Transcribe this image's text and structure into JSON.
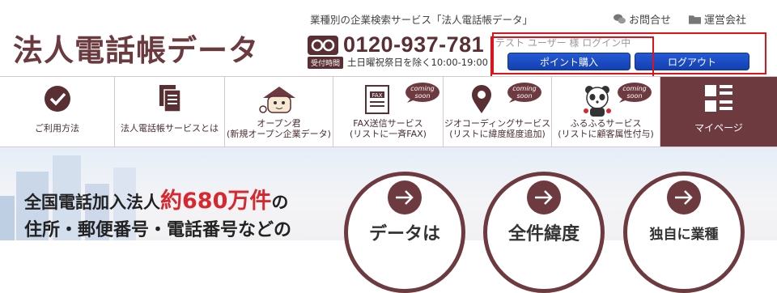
{
  "header": {
    "logo": "法人電話帳データ",
    "tagline": "業種別の企業検索サービス「法人電話帳データ」",
    "links": [
      {
        "label": "お問合せ",
        "icon": "chat-icon"
      },
      {
        "label": "運営会社",
        "icon": "folder-icon"
      }
    ],
    "phone": "0120-937-781",
    "hours_badge": "受付時間",
    "hours": "土日曜祝祭日を除く10:00-19:00",
    "user_status": "テスト ユーザー 様 ログイン中",
    "point_button": "ポイント購入",
    "logout_button": "ログアウト"
  },
  "nav": {
    "coming_label": "coming soon",
    "items": [
      {
        "line1": "ご利用方法",
        "line2": "",
        "icon": "check-circle-icon",
        "coming": false
      },
      {
        "line1": "法人電話帳サービスとは",
        "line2": "",
        "icon": "document-icon",
        "coming": false
      },
      {
        "line1": "オープン君",
        "line2": "(新規オープン企業データ)",
        "icon": "house-mascot-icon",
        "coming": false
      },
      {
        "line1": "FAX送信サービス",
        "line2": "(リストに一斉FAX)",
        "icon": "fax-icon",
        "coming": true
      },
      {
        "line1": "ジオコーディングサービス",
        "line2": "(リストに緯度経度追加)",
        "icon": "map-pin-icon",
        "coming": true
      },
      {
        "line1": "ふるふるサービス",
        "line2": "(リストに顧客属性付与)",
        "icon": "panda-mascot-icon",
        "coming": true
      },
      {
        "line1": "マイページ",
        "line2": "",
        "icon": "grid-list-icon",
        "coming": false
      }
    ]
  },
  "hero": {
    "line1_pre": "全国電話加入法人",
    "line1_num": "約680万件",
    "line1_post": "の",
    "line2": "住所・郵便番号・電話番号などの",
    "circles": [
      "データは",
      "全件緯度",
      "独自に業種"
    ]
  },
  "colors": {
    "brand": "#6d3a40",
    "accent_red": "#d9272e",
    "button_blue": "#1b4cc4",
    "highlight": "#e0121a"
  }
}
